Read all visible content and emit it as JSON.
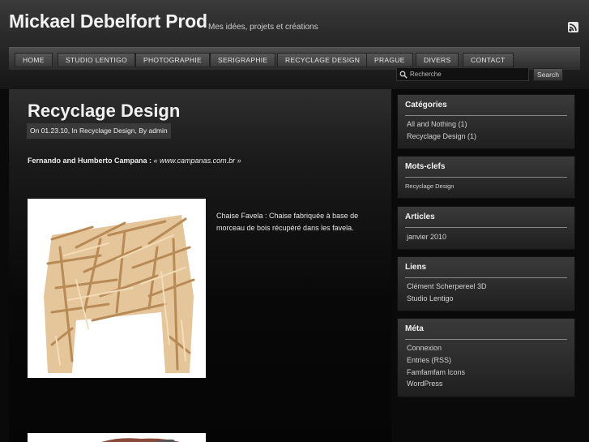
{
  "site": {
    "title": "Mickael Debelfort Prod",
    "tagline": "Mes idées, projets et créations",
    "rss_icon": "rss-icon"
  },
  "nav": {
    "items": [
      {
        "label": "HOME"
      },
      {
        "label": "STUDIO LENTIGO"
      },
      {
        "label": "PHOTOGRAPHIE"
      },
      {
        "label": "SERIGRAPHIE"
      },
      {
        "label": "RECYCLAGE DESIGN"
      },
      {
        "label": "PRAGUE"
      },
      {
        "label": "DIVERS"
      },
      {
        "label": "CONTACT"
      }
    ]
  },
  "search": {
    "placeholder": "Recherche",
    "button_label": "Search"
  },
  "post": {
    "title": "Recyclage Design",
    "meta": "On 01.23.10, In Recyclage Design, By admin",
    "intro_bold": "Fernando and Humberto Campana :",
    "intro_link": "« www.campanas.com.br »",
    "caption": "Chaise Favela : Chaise fabriquée à base de morceau de bois récupéré dans les favela."
  },
  "sidebar": {
    "categories": {
      "title": "Catégories",
      "items": [
        {
          "label": "All and Nothing (1)"
        },
        {
          "label": "Recyclage Design (1)"
        }
      ]
    },
    "tags": {
      "title": "Mots-clefs",
      "items": [
        {
          "label": "Recyclage Design"
        }
      ]
    },
    "archives": {
      "title": "Articles",
      "items": [
        {
          "label": "janvier 2010"
        }
      ]
    },
    "links": {
      "title": "Liens",
      "items": [
        {
          "label": "Clément Scherpereel 3D"
        },
        {
          "label": "Studio Lentigo"
        }
      ]
    },
    "meta": {
      "title": "Méta",
      "items": [
        {
          "label": "Connexion"
        },
        {
          "label": "Entries (RSS)"
        },
        {
          "label": "Famfamfam Icons"
        },
        {
          "label": "WordPress"
        }
      ]
    }
  },
  "colors": {
    "background": "#0a0a0a",
    "header": "#2a2a2a",
    "text": "#dddddd",
    "post_meta_bg": "#3a3a3a"
  }
}
